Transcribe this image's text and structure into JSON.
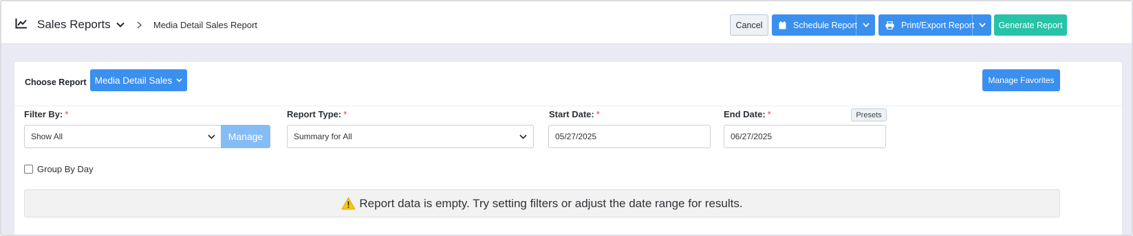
{
  "header": {
    "app_title": "Sales Reports",
    "app_icon": "chart-line-icon",
    "breadcrumb_current": "Media Detail Sales Report",
    "buttons": {
      "cancel": "Cancel",
      "schedule": "Schedule Report",
      "print_export": "Print/Export Report",
      "generate": "Generate Report"
    }
  },
  "report": {
    "choose_label": "Choose Report",
    "selected_report": "Media Detail Sales",
    "manage_favorites": "Manage Favorites"
  },
  "filters": {
    "filter_by": {
      "label": "Filter By:",
      "value": "Show All",
      "manage_label": "Manage"
    },
    "report_type": {
      "label": "Report Type:",
      "value": "Summary for All"
    },
    "start_date": {
      "label": "Start Date:",
      "value": "05/27/2025"
    },
    "end_date": {
      "label": "End Date:",
      "value": "06/27/2025"
    },
    "presets_label": "Presets",
    "required_mark": "*",
    "group_by_day": {
      "label": "Group By Day",
      "checked": false
    }
  },
  "alert": {
    "icon": "warning-triangle-icon",
    "message": "Report data is empty. Try setting filters or adjust the date range for results."
  },
  "colors": {
    "primary": "#3a8fef",
    "success": "#26c3a8",
    "required": "#e53a3a",
    "warning": "#f5c518"
  }
}
